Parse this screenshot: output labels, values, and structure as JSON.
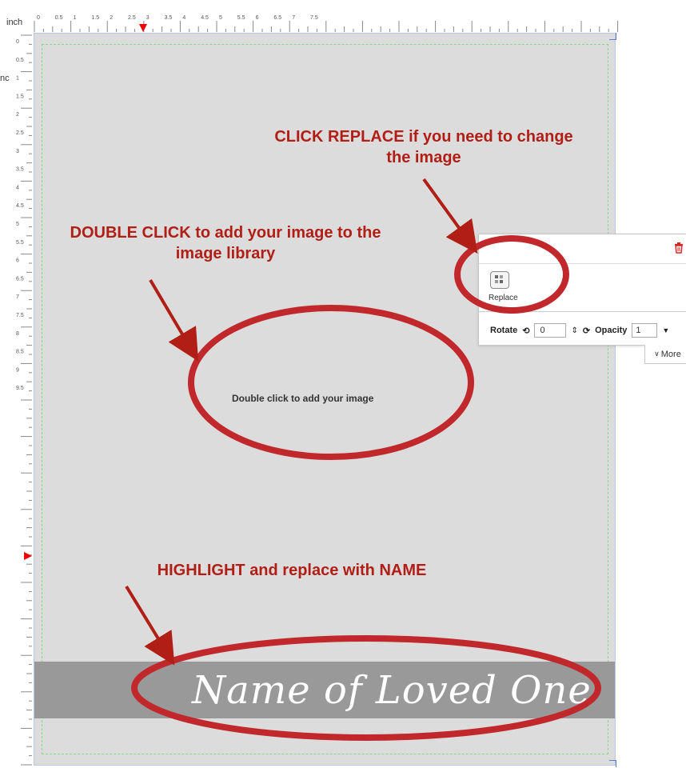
{
  "ruler": {
    "unit": "inch",
    "top_ticks": [
      "0",
      "0.5",
      "1",
      "1.5",
      "2",
      "2.5",
      "3",
      "3.5",
      "4",
      "4.5",
      "5",
      "5.5",
      "6",
      "6.5",
      "7",
      "7.5"
    ],
    "left_ticks": [
      "0",
      "0.5",
      "1",
      "1.5",
      "2",
      "2.5",
      "3",
      "3.5",
      "4",
      "4.5",
      "5",
      "5.5",
      "6",
      "6.5",
      "7",
      "7.5",
      "8",
      "8.5",
      "9",
      "9.5"
    ]
  },
  "left_cut_text": "nc",
  "canvas": {
    "placeholder_text": "Double click to add your image",
    "name_text": "Name of Loved One"
  },
  "panel": {
    "replace_label": "Replace",
    "rotate_label": "Rotate",
    "rotate_value": "0",
    "opacity_label": "Opacity",
    "opacity_value": "1",
    "more_label": "More"
  },
  "annotations": {
    "replace": "CLICK REPLACE if you need to change the image",
    "double_click": "DOUBLE CLICK to add your image to the image library",
    "highlight": "HIGHLIGHT and replace with NAME"
  },
  "colors": {
    "annotation": "#b01e16",
    "ellipse": "#c0282c",
    "canvas_bg": "#dcdcdc",
    "name_band": "#999999",
    "guide": "#86d98a"
  }
}
